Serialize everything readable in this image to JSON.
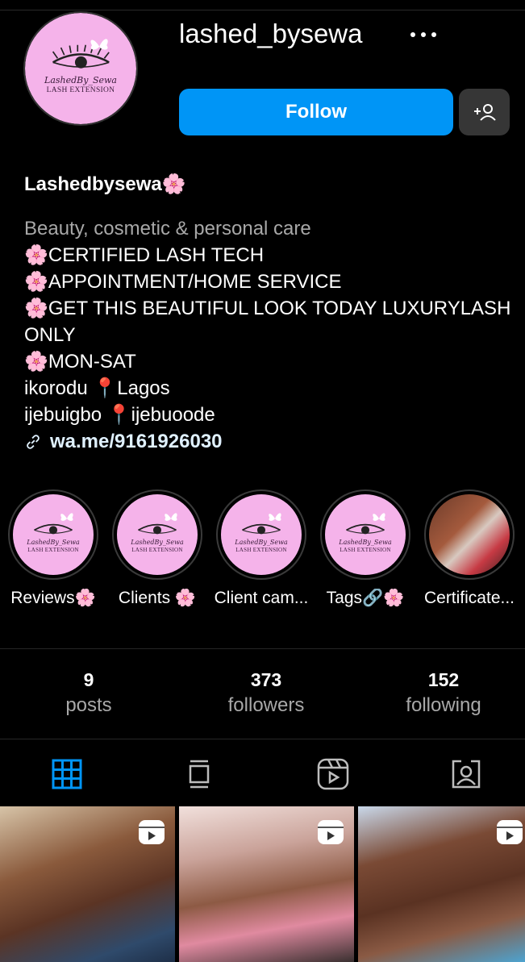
{
  "profile": {
    "username": "lashed_bysewa",
    "display_name": "Lashedbysewa🌸",
    "avatar": {
      "script": "LashedBy_Sewa",
      "subtitle": "LASH EXTENSION"
    }
  },
  "actions": {
    "follow_label": "Follow",
    "more_icon": "more-horizontal-icon",
    "add_user_icon": "add-user-icon"
  },
  "bio": {
    "category": "Beauty, cosmetic & personal care",
    "lines": [
      "🌸CERTIFIED LASH TECH",
      "🌸APPOINTMENT/HOME SERVICE",
      "🌸GET THIS BEAUTIFUL LOOK TODAY LUXURYLASH ONLY",
      "🌸MON-SAT",
      "ikorodu 📍Lagos",
      "ijebuigbo 📍ijebuoode"
    ],
    "link": "wa.me/9161926030"
  },
  "highlights": [
    {
      "label": "Reviews🌸",
      "cover": "logo"
    },
    {
      "label": "Clients 🌸",
      "cover": "logo"
    },
    {
      "label": "Client cam...",
      "cover": "logo"
    },
    {
      "label": "Tags🔗🌸",
      "cover": "logo"
    },
    {
      "label": "Certificate...",
      "cover": "photo"
    }
  ],
  "stats": {
    "posts": {
      "value": "9",
      "label": "posts"
    },
    "followers": {
      "value": "373",
      "label": "followers"
    },
    "following": {
      "value": "152",
      "label": "following"
    }
  },
  "tabs": [
    {
      "icon": "grid-icon",
      "active": true
    },
    {
      "icon": "feed-icon",
      "active": false
    },
    {
      "icon": "reels-icon",
      "active": false
    },
    {
      "icon": "tagged-icon",
      "active": false
    }
  ],
  "colors": {
    "accent": "#0095f6",
    "logo_pink": "#f5b3ea",
    "secondary_text": "#a8a8a8",
    "active_tab": "#0095f6"
  },
  "posts": [
    {
      "type": "reel"
    },
    {
      "type": "reel"
    },
    {
      "type": "reel"
    }
  ]
}
